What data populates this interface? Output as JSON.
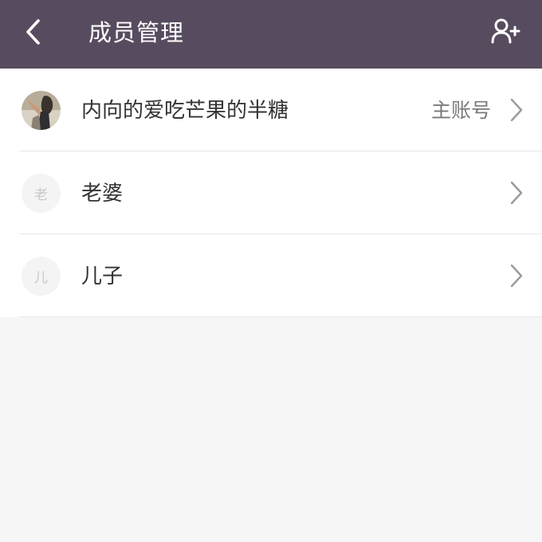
{
  "header": {
    "title": "成员管理",
    "back_icon": "chevron-left-icon",
    "add_icon": "add-member-icon",
    "background": "#574c5f"
  },
  "members": [
    {
      "name": "内向的爱吃芒果的半糖",
      "badge": "主账号",
      "avatar": "photo"
    },
    {
      "name": "老婆",
      "avatar_letter": "老"
    },
    {
      "name": "儿子",
      "avatar_letter": "儿"
    }
  ]
}
